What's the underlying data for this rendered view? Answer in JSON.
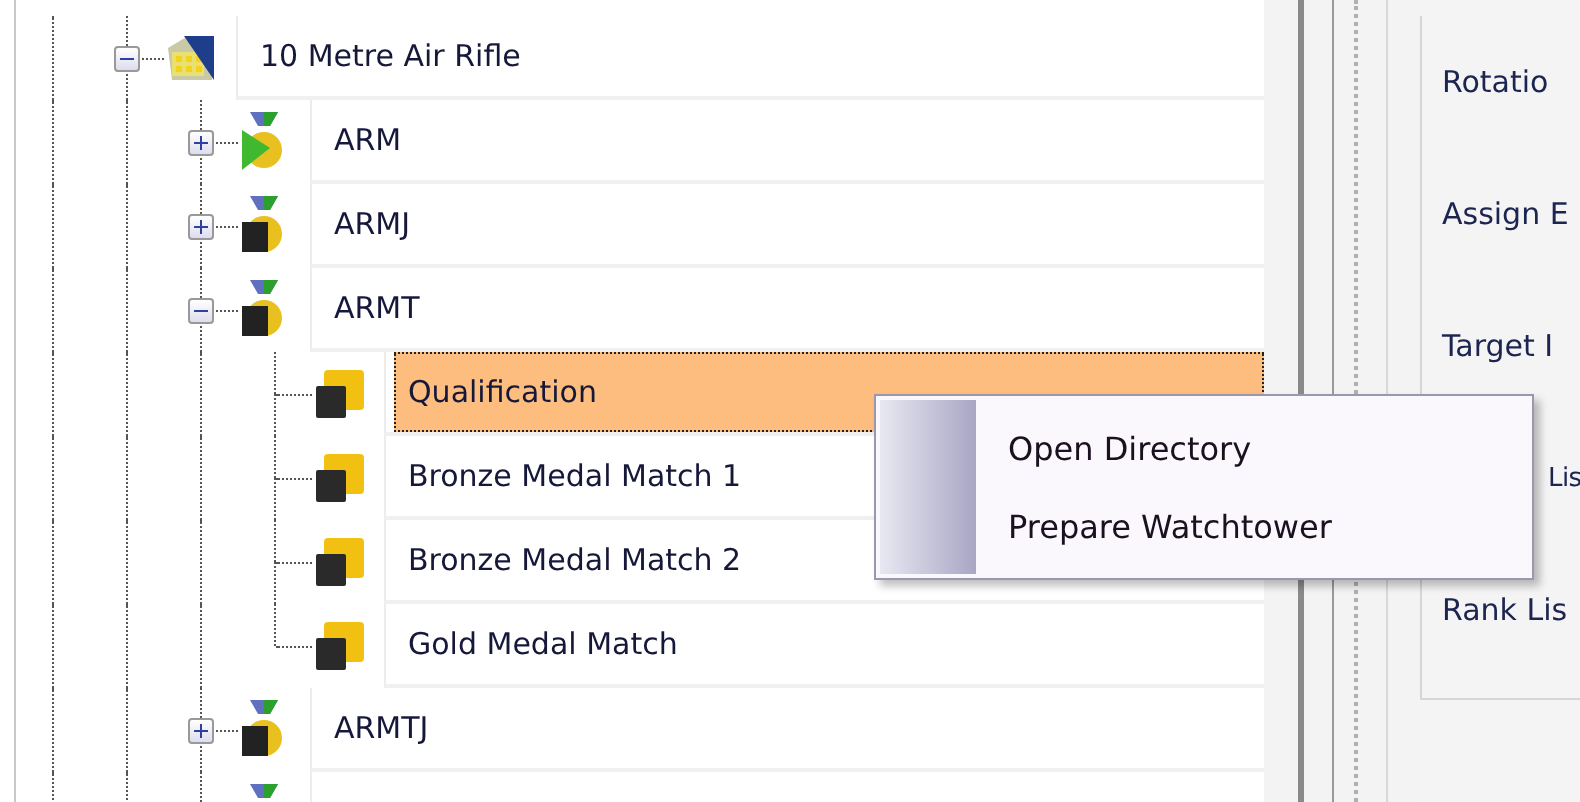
{
  "tree": [
    {
      "label": "10 Metre Air Rifle",
      "kind": "building",
      "expanded": true,
      "selected": false,
      "children": [
        {
          "label": "ARM",
          "kind": "medal-play",
          "expanded": false,
          "selected": false
        },
        {
          "label": "ARMJ",
          "kind": "medal",
          "expanded": false,
          "selected": false
        },
        {
          "label": "ARMT",
          "kind": "medal",
          "expanded": true,
          "selected": false,
          "children": [
            {
              "label": "Qualification",
              "kind": "stage",
              "selected": true
            },
            {
              "label": "Bronze Medal Match 1",
              "kind": "stage",
              "selected": false
            },
            {
              "label": "Bronze Medal Match 2",
              "kind": "stage",
              "selected": false
            },
            {
              "label": "Gold Medal Match",
              "kind": "stage",
              "selected": false
            }
          ]
        },
        {
          "label": "ARMTJ",
          "kind": "medal",
          "expanded": false,
          "selected": false
        },
        {
          "kind": "medal"
        }
      ]
    }
  ],
  "context_menu": {
    "items": [
      "Open Directory",
      "Prepare Watchtower"
    ]
  },
  "side_panel": {
    "labels": [
      {
        "text": "Rotatio",
        "kind": "plain"
      },
      {
        "text": "Assign E",
        "kind": "plain"
      },
      {
        "text": "Target I",
        "kind": "plain"
      },
      {
        "text": "Lis",
        "kind": "covered"
      },
      {
        "text": "Rank Lis",
        "kind": "plain"
      }
    ]
  }
}
